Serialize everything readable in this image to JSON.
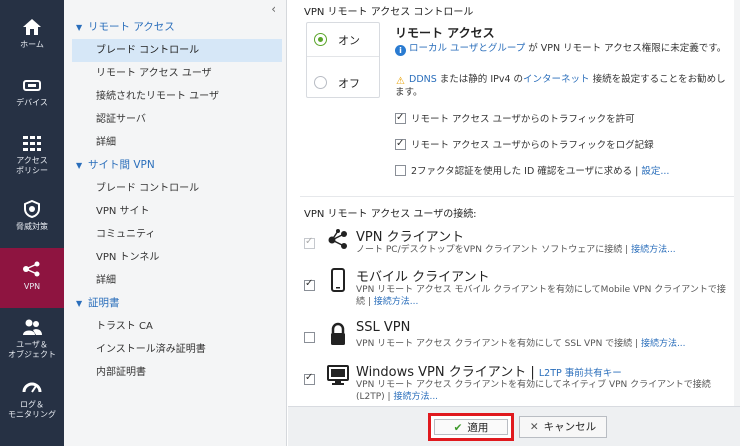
{
  "nav": [
    {
      "key": "home",
      "label": "ホーム",
      "icon": "home-icon"
    },
    {
      "key": "devices",
      "label": "デバイス",
      "icon": "devices-icon"
    },
    {
      "key": "access",
      "label": "アクセス\nポリシー",
      "icon": "access-policy-icon"
    },
    {
      "key": "threat",
      "label": "脅威対策",
      "icon": "shield-icon"
    },
    {
      "key": "vpn",
      "label": "VPN",
      "icon": "vpn-icon"
    },
    {
      "key": "users",
      "label": "ユーザ＆\nオブジェクト",
      "icon": "users-icon"
    },
    {
      "key": "logs",
      "label": "ログ＆\nモニタリング",
      "icon": "gauge-icon"
    }
  ],
  "sidebar": {
    "collapse_glyph": "‹",
    "sections": [
      {
        "title": "リモート アクセス",
        "items": [
          "ブレード コントロール",
          "リモート アクセス ユーザ",
          "接続されたリモート ユーザ",
          "認証サーバ",
          "詳細"
        ]
      },
      {
        "title": "サイト間 VPN",
        "items": [
          "ブレード コントロール",
          "VPN サイト",
          "コミュニティ",
          "VPN トンネル",
          "詳細"
        ]
      },
      {
        "title": "証明書",
        "items": [
          "トラスト CA",
          "インストール済み証明書",
          "内部証明書"
        ]
      }
    ]
  },
  "main": {
    "section_title": "VPN リモート アクセス コントロール",
    "on_label": "オン",
    "off_label": "オフ",
    "ra_title": "リモート アクセス",
    "info_link": "ローカル ユーザとグループ",
    "info_text": " が VPN リモート アクセス権限に未定義です。",
    "warn_link1": "DDNS",
    "warn_text1": " または静的 IPv4 の",
    "warn_link2": "インターネット",
    "warn_text2": " 接続を設定することをお勧めします。",
    "options": [
      {
        "label": "リモート アクセス ユーザからのトラフィックを許可",
        "checked": true
      },
      {
        "label": "リモート アクセス ユーザからのトラフィックをログ記録",
        "checked": true
      },
      {
        "label": "2ファクタ認証を使用した ID 確認をユーザに求める",
        "checked": false,
        "link": "設定..."
      }
    ],
    "connections_title": "VPN リモート アクセス ユーザの接続:",
    "clients": [
      {
        "title": "VPN クライアント",
        "sub": "",
        "desc": "ノート PC/デスクトップをVPN クライアント ソフトウェアに接続",
        "link": "接続方法...",
        "checked": true,
        "disabled": true,
        "icon": "network-icon"
      },
      {
        "title": "モバイル クライアント",
        "sub": "",
        "desc": "VPN リモート アクセス モバイル クライアントを有効にしてMobile VPN クライアントで接続",
        "link": "接続方法...",
        "checked": true,
        "disabled": false,
        "icon": "mobile-icon"
      },
      {
        "title": "SSL VPN",
        "sub": "",
        "desc": "VPN リモート アクセス クライアントを有効にして SSL VPN で接続",
        "link": "接続方法...",
        "checked": false,
        "disabled": false,
        "icon": "lock-icon"
      },
      {
        "title": "Windows VPN クライアント",
        "sub": "L2TP 事前共有キー",
        "desc": "VPN リモート アクセス クライアントを有効にしてネイティブ VPN クライアントで接続 (L2TP)",
        "link": "接続方法...",
        "checked": true,
        "disabled": false,
        "icon": "monitor-icon"
      }
    ],
    "apply_label": "適用",
    "cancel_label": "キャンセル"
  },
  "colors": {
    "nav_bg": "#263144",
    "nav_active": "#8e1440",
    "link": "#2a6ebb",
    "highlight": "#e0191e",
    "radio_on": "#5aa52a"
  }
}
